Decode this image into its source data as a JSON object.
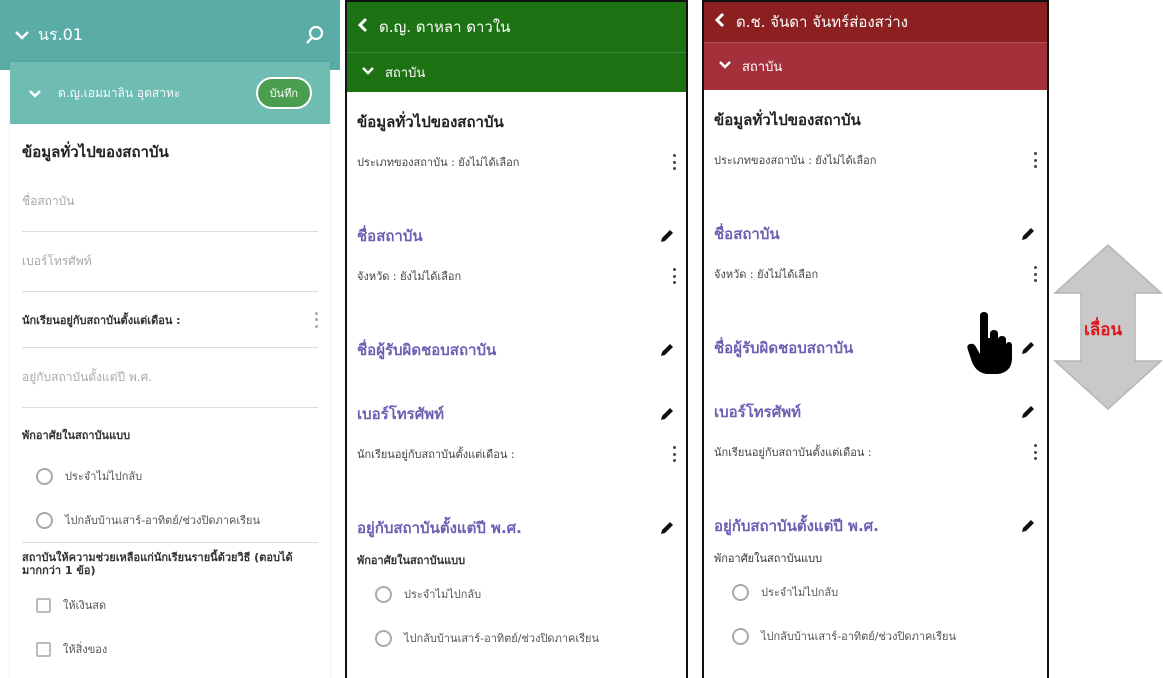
{
  "screen1": {
    "header_title": "นร.01",
    "student_name": "ด.ญ.เอมมาลิน อุตสาหะ",
    "save_label": "บันทึก",
    "section_title": "ข้อมูลทั่วไปของสถาบัน",
    "field_institution_name_placeholder": "ชื่อสถาบัน",
    "field_phone_placeholder": "เบอร์โทรศัพท์",
    "q_stay_since_month": "นักเรียนอยู่กับสถาบันตั้งแต่เดือน :",
    "field_stay_since_year_placeholder": "อยู่กับสถาบันตั้งแต่ปี พ.ศ.",
    "boarding_label": "พักอาศัยในสถาบันแบบ",
    "boarding_options": [
      "ประจำไม่ไปกลับ",
      "ไปกลับบ้านเสาร์-อาทิตย์/ช่วงปิดภาคเรียน"
    ],
    "support_label": "สถาบันให้ความช่วยเหลือแก่นักเรียนรายนี้ด้วยวิธี (ตอบได้มากกว่า 1 ข้อ)",
    "support_options": [
      "ให้เงินสด",
      "ให้สิ่งของ"
    ]
  },
  "screen2": {
    "header_title": "ด.ญ. ดาหลา ดาวใน",
    "sub_title": "สถาบัน",
    "section_title": "ข้อมูลทั่วไปของสถาบัน",
    "type_row": "ประเภทของสถาบัน : ยังไม่ได้เลือก",
    "institution_name": "ชื่อสถาบัน",
    "province_row": "จังหวัด : ยังไม่ได้เลือก",
    "responsible_person": "ชื่อผู้รับผิดชอบสถาบัน",
    "phone": "เบอร์โทรศัพท์",
    "stay_month_row": "นักเรียนอยู่กับสถาบันตั้งแต่เดือน :",
    "stay_year": "อยู่กับสถาบันตั้งแต่ปี พ.ศ.",
    "boarding_label": "พักอาศัยในสถาบันแบบ",
    "boarding_options": [
      "ประจำไม่ไปกลับ",
      "ไปกลับบ้านเสาร์-อาทิตย์/ช่วงปิดภาคเรียน"
    ]
  },
  "screen3": {
    "header_title": "ด.ช. จันดา จันทร์ส่องสว่าง",
    "sub_title": "สถาบัน",
    "section_title": "ข้อมูลทั่วไปของสถาบัน",
    "type_row": "ประเภทของสถาบัน : ยังไม่ได้เลือก",
    "institution_name": "ชื่อสถาบัน",
    "province_row": "จังหวัด : ยังไม่ได้เลือก",
    "responsible_person": "ชื่อผู้รับผิดชอบสถาบัน",
    "phone": "เบอร์โทรศัพท์",
    "stay_month_row": "นักเรียนอยู่กับสถาบันตั้งแต่เดือน :",
    "stay_year": "อยู่กับสถาบันตั้งแต่ปี พ.ศ.",
    "boarding_label": "พักอาศัยในสถาบันแบบ",
    "boarding_options": [
      "ประจำไม่ไปกลับ",
      "ไปกลับบ้านเสาร์-อาทิตย์/ช่วงปิดภาคเรียน"
    ]
  },
  "scroll_hint": "เลื่อน",
  "colors": {
    "teal_header": "#5aaca6",
    "green_header": "#1d7314",
    "red_header": "#8c2021",
    "link_purple": "#6e5fb3",
    "hint_red": "#e0161d"
  }
}
